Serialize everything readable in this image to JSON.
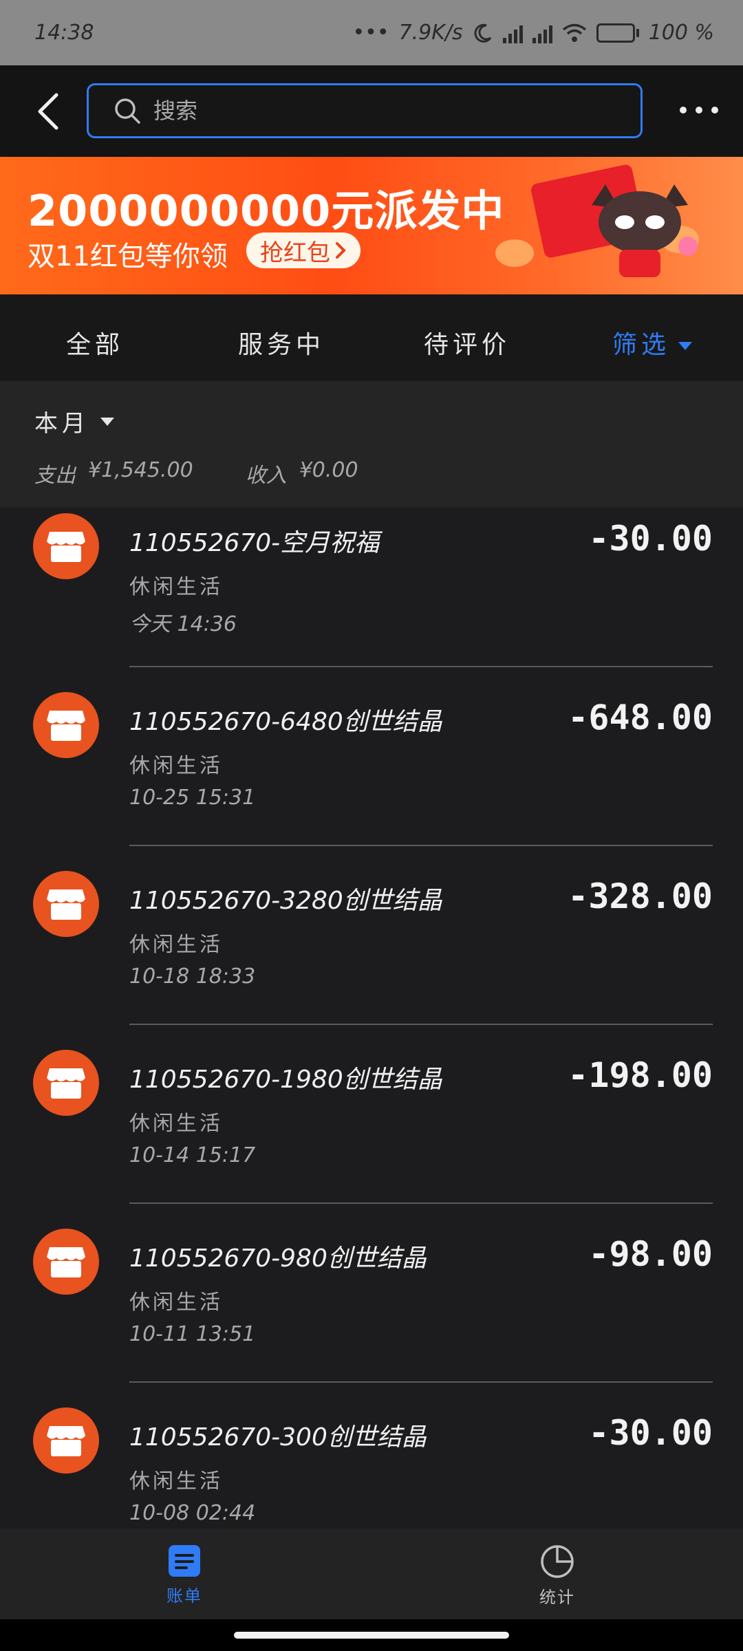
{
  "status_bar": {
    "time": "14:38",
    "net_speed": "7.9K/s",
    "battery": "100 %",
    "battery_level": 1.0
  },
  "header": {
    "search_placeholder": "搜索"
  },
  "banner": {
    "title": "2000000000元派发中",
    "subtitle": "双11红包等你领",
    "button": "抢红包"
  },
  "tabs": [
    {
      "label": "全部",
      "active": false
    },
    {
      "label": "服务中",
      "active": false
    },
    {
      "label": "待评价",
      "active": false
    },
    {
      "label": "筛选",
      "active": true
    }
  ],
  "summary": {
    "period": "本月",
    "expense_label": "支出",
    "expense_value": "¥1,545.00",
    "income_label": "收入",
    "income_value": "¥0.00"
  },
  "transactions": [
    {
      "title": "110552670-空月祝福",
      "category": "休闲生活",
      "time": "今天 14:36",
      "amount": "-30.00"
    },
    {
      "title": "110552670-6480创世结晶",
      "category": "休闲生活",
      "time": "10-25 15:31",
      "amount": "-648.00"
    },
    {
      "title": "110552670-3280创世结晶",
      "category": "休闲生活",
      "time": "10-18 18:33",
      "amount": "-328.00"
    },
    {
      "title": "110552670-1980创世结晶",
      "category": "休闲生活",
      "time": "10-14 15:17",
      "amount": "-198.00"
    },
    {
      "title": "110552670-980创世结晶",
      "category": "休闲生活",
      "time": "10-11 13:51",
      "amount": "-98.00"
    },
    {
      "title": "110552670-300创世结晶",
      "category": "休闲生活",
      "time": "10-08 02:44",
      "amount": "-30.00"
    }
  ],
  "bottom_nav": {
    "bill_label": "账单",
    "stats_label": "统计"
  },
  "colors": {
    "accent": "#2f7cf6",
    "merchant_icon_bg": "#e8531f",
    "background": "#1c1c1e"
  },
  "icons": {
    "back": "chevron-left-icon",
    "search": "search-icon",
    "more": "more-icon",
    "merchant": "shop-icon",
    "bill": "bill-icon",
    "stats": "pie-chart-icon"
  }
}
